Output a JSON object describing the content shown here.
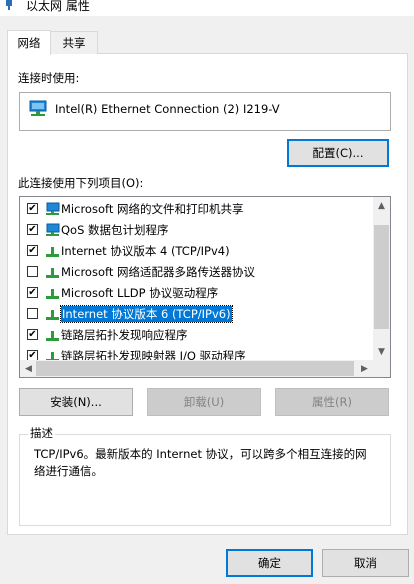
{
  "window": {
    "title": "以太网 属性"
  },
  "tabs": [
    {
      "label": "网络",
      "active": true
    },
    {
      "label": "共享",
      "active": false
    }
  ],
  "connect_using": {
    "label": "连接时使用:",
    "adapter_name": "Intel(R) Ethernet Connection (2) I219-V",
    "adapter_icon": "network-adapter-icon"
  },
  "configure_button": "配置(C)...",
  "items_label": "此连接使用下列项目(O):",
  "items": [
    {
      "label": "Microsoft 网络的文件和打印机共享",
      "checked": true,
      "icon": "network-client-icon",
      "selected": false
    },
    {
      "label": "QoS 数据包计划程序",
      "checked": true,
      "icon": "network-client-icon",
      "selected": false
    },
    {
      "label": "Internet 协议版本 4 (TCP/IPv4)",
      "checked": true,
      "icon": "protocol-icon",
      "selected": false
    },
    {
      "label": "Microsoft 网络适配器多路传送器协议",
      "checked": false,
      "icon": "protocol-icon",
      "selected": false
    },
    {
      "label": "Microsoft LLDP 协议驱动程序",
      "checked": true,
      "icon": "protocol-icon",
      "selected": false
    },
    {
      "label": "Internet 协议版本 6 (TCP/IPv6)",
      "checked": false,
      "icon": "protocol-icon",
      "selected": true
    },
    {
      "label": "链路层拓扑发现响应程序",
      "checked": true,
      "icon": "protocol-icon",
      "selected": false
    },
    {
      "label": "链路层拓扑发现映射器 I/O 驱动程序",
      "checked": true,
      "icon": "protocol-icon",
      "selected": false
    }
  ],
  "buttons": {
    "install": "安装(N)...",
    "uninstall": "卸载(U)",
    "properties": "属性(R)",
    "ok": "确定",
    "cancel": "取消"
  },
  "description": {
    "title": "描述",
    "text": "TCP/IPv6。最新版本的 Internet 协议，可以跨多个相互连接的网络进行通信。"
  },
  "colors": {
    "selection": "#0078d7",
    "icon_green": "#2e9b3a",
    "monitor_blue": "#1e88d6"
  }
}
